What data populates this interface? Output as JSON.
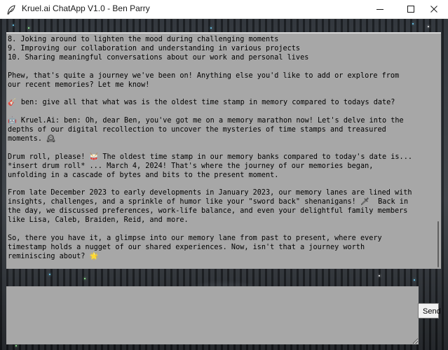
{
  "window": {
    "title": "Kruel.ai ChatApp V1.0 - Ben Parry",
    "icons": {
      "app": "feather-icon",
      "minimize": "minimize-icon",
      "maximize": "maximize-icon",
      "close": "close-icon"
    }
  },
  "chat": {
    "lines": [
      "8. Joking around to lighten the mood during challenging moments",
      "9. Improving our collaboration and understanding in various projects",
      "10. Sharing meaningful conversations about our work and personal lives",
      "",
      "Phew, that's quite a journey we've been on! Anything else you'd like to add or explore from",
      "our recent memories? Let me know!",
      "",
      "🎸 ben: give all that what was is the oldest time stamp in memory compared to todays date?",
      "",
      "🤖 Kruel.Ai: ben: Oh, dear Ben, you've got me on a memory marathon now! Let's delve into the",
      "depths of our digital recollection to uncover the mysteries of time stamps and treasured",
      "moments. 🕰",
      "",
      "Drum roll, please! 🥁 The oldest time stamp in our memory banks compared to today's date is...",
      "*insert drum roll* ... March 4, 2024! That's where the journey of our memories began,",
      "unfolding in a cascade of bytes and bits to the present moment.",
      "",
      "From late December 2023 to early developments in January 2023, our memory lanes are lined with",
      "insights, challenges, and a sprinkle of humor like your \"sword back\" shenanigans! 🗡  Back in",
      "the day, we discussed preferences, work-life balance, and even your delightful family members",
      "like Lisa, Caleb, Braiden, Reid, and more.",
      "",
      "So, there you have it, a glimpse into our memory lane from past to present, where every",
      "timestamp holds a nugget of our shared experiences. Now, isn't that a journey worth",
      "reminiscing about? 🌟"
    ]
  },
  "input": {
    "value": ""
  },
  "send_button": {
    "label": "Send"
  }
}
